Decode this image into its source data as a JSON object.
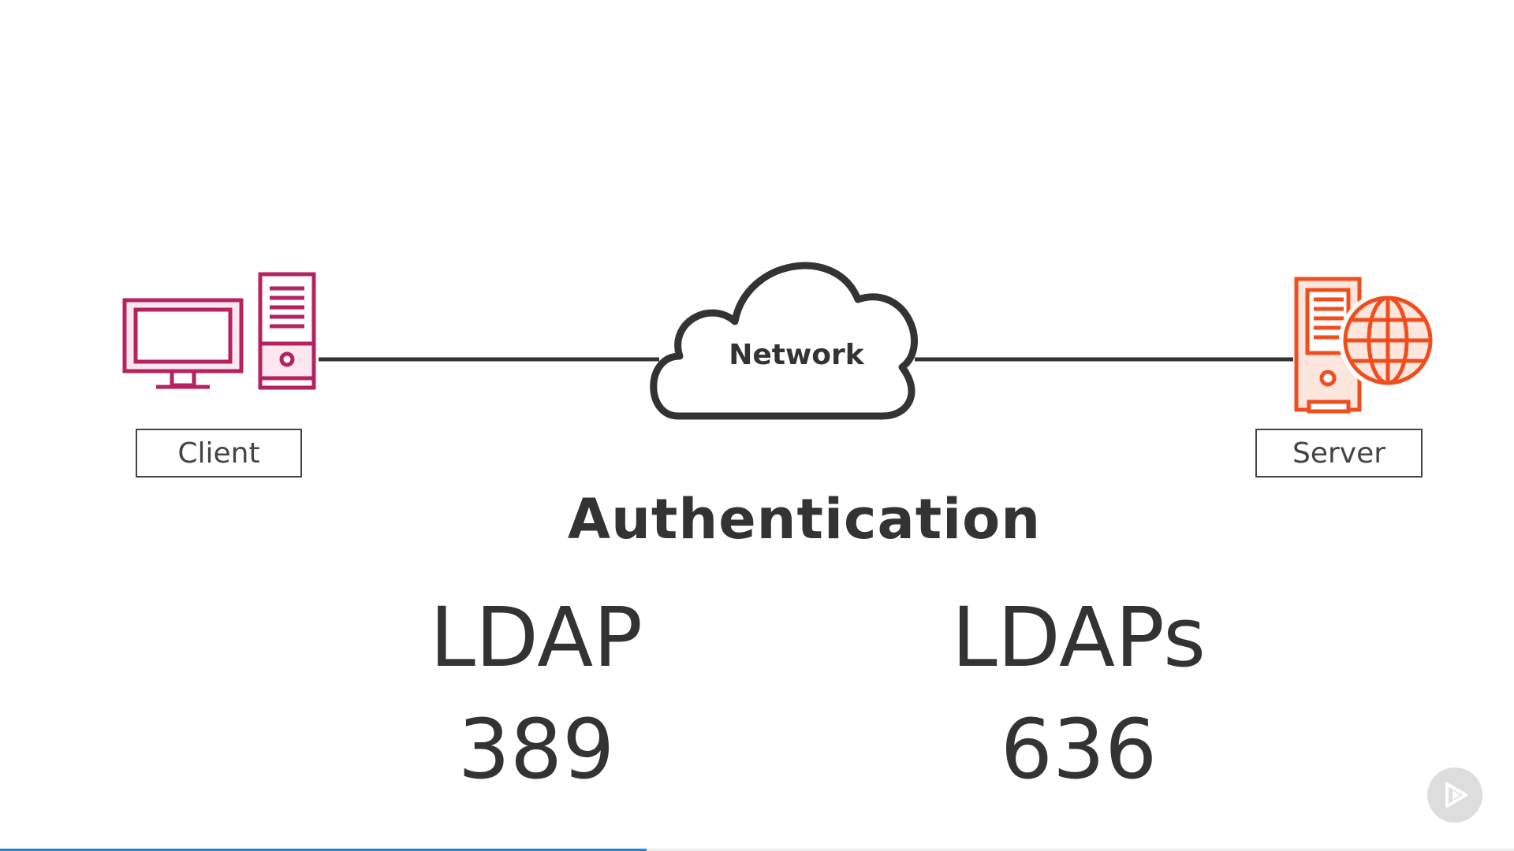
{
  "diagram": {
    "cloud_label": "Network",
    "client_label": "Client",
    "server_label": "Server",
    "subtitle": "Authentication",
    "protocols": [
      {
        "name": "LDAP",
        "port": "389"
      },
      {
        "name": "LDAPs",
        "port": "636"
      }
    ]
  },
  "icons": {
    "client": "desktop-computer-icon",
    "cloud": "cloud-icon",
    "server": "web-server-icon",
    "player": "play-icon"
  },
  "colors": {
    "client": "#b5225f",
    "server": "#f04e1f",
    "line": "#333333",
    "progress": "#1e88d6"
  },
  "player": {
    "progress": 0.427
  }
}
